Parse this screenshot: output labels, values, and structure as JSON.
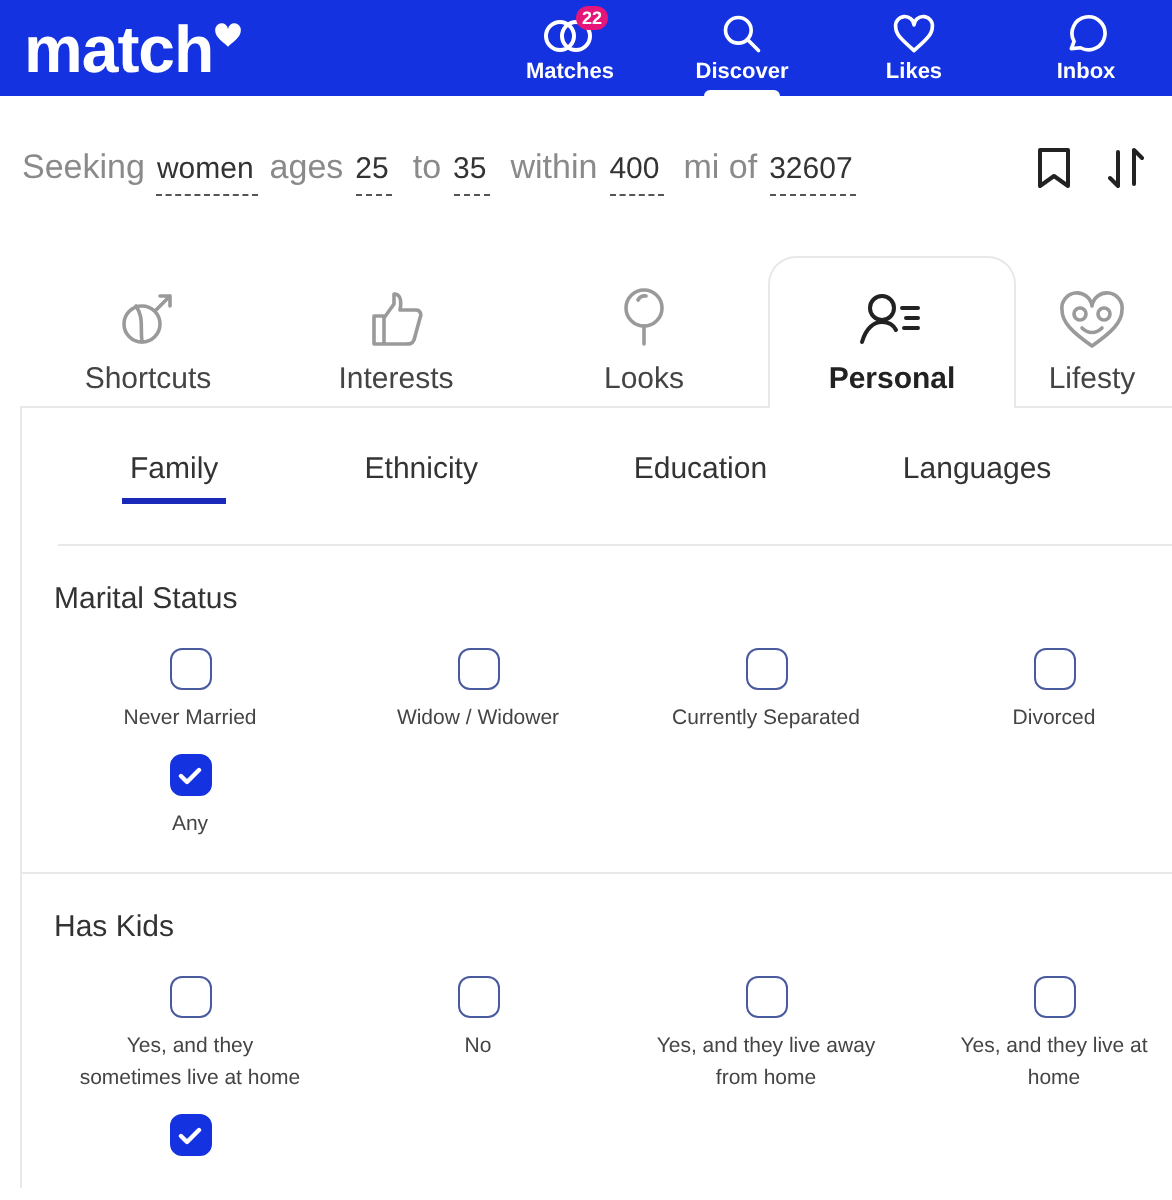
{
  "header": {
    "logo": "match",
    "nav": [
      {
        "kind": "matches",
        "label": "Matches",
        "badge": "22",
        "selected": false
      },
      {
        "kind": "discover",
        "label": "Discover",
        "selected": true
      },
      {
        "kind": "likes",
        "label": "Likes",
        "selected": false
      },
      {
        "kind": "inbox",
        "label": "Inbox",
        "selected": false
      }
    ]
  },
  "search": {
    "parts": [
      {
        "kind": "text",
        "text": "Seeking"
      },
      {
        "kind": "value",
        "text": "women"
      },
      {
        "kind": "text",
        "text": "ages"
      },
      {
        "kind": "value",
        "text": "25"
      },
      {
        "kind": "text",
        "text": "to"
      },
      {
        "kind": "value",
        "text": "35"
      },
      {
        "kind": "text",
        "text": "within"
      },
      {
        "kind": "value",
        "text": "400"
      },
      {
        "kind": "text",
        "text": "mi of"
      },
      {
        "kind": "value",
        "text": "32607"
      }
    ]
  },
  "category_tabs": [
    {
      "kind": "shortcuts",
      "label": "Shortcuts",
      "selected": false
    },
    {
      "kind": "interests",
      "label": "Interests",
      "selected": false
    },
    {
      "kind": "looks",
      "label": "Looks",
      "selected": false
    },
    {
      "kind": "personal",
      "label": "Personal",
      "selected": true
    },
    {
      "kind": "lifestyle",
      "label": "Lifesty",
      "selected": false
    }
  ],
  "sub_tabs": [
    {
      "label": "Family",
      "selected": true
    },
    {
      "label": "Ethnicity",
      "selected": false
    },
    {
      "label": "Education",
      "selected": false
    },
    {
      "label": "Languages",
      "selected": false
    }
  ],
  "sections": [
    {
      "title": "Marital Status",
      "options": [
        {
          "label": "Never Married",
          "checked": false
        },
        {
          "label": "Widow / Widower",
          "checked": false
        },
        {
          "label": "Currently Separated",
          "checked": false
        },
        {
          "label": "Divorced",
          "checked": false
        },
        {
          "label": "Any",
          "checked": true
        }
      ]
    },
    {
      "title": "Has Kids",
      "options": [
        {
          "label": "Yes, and they sometimes live at home",
          "checked": false
        },
        {
          "label": "No",
          "checked": false
        },
        {
          "label": "Yes, and they live away from home",
          "checked": false
        },
        {
          "label": "Yes, and they live at home",
          "checked": false
        },
        {
          "checked": true
        }
      ]
    }
  ]
}
